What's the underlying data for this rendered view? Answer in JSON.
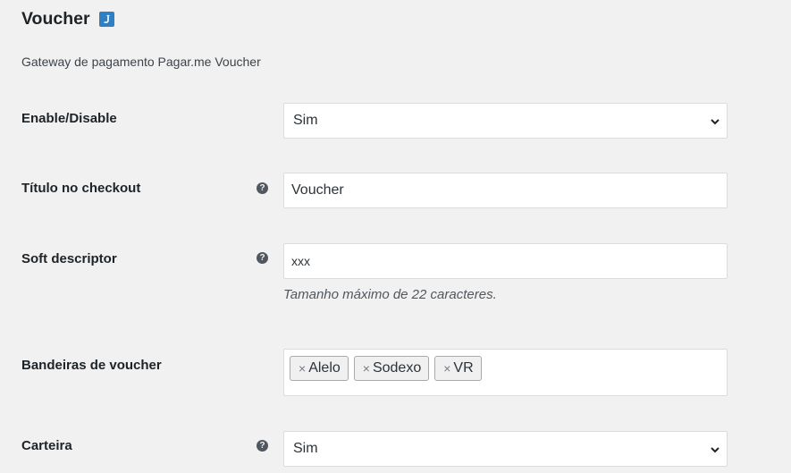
{
  "header": {
    "title": "Voucher",
    "return_icon": "return-arrow-icon",
    "subtitle": "Gateway de pagamento Pagar.me Voucher"
  },
  "fields": {
    "enable": {
      "label": "Enable/Disable",
      "value": "Sim"
    },
    "title": {
      "label": "Título no checkout",
      "value": "Voucher",
      "help_icon": "help-icon"
    },
    "soft_descriptor": {
      "label": "Soft descriptor",
      "value": "xxx",
      "description": "Tamanho máximo de 22 caracteres.",
      "help_icon": "help-icon"
    },
    "brands": {
      "label": "Bandeiras de voucher",
      "remove_symbol": "×",
      "tags": [
        "Alelo",
        "Sodexo",
        "VR"
      ]
    },
    "wallet": {
      "label": "Carteira",
      "value": "Sim",
      "help_icon": "help-icon"
    }
  },
  "help_symbol": "?",
  "colors": {
    "background": "#f1f1f1",
    "accent": "#2f7fc4",
    "border": "#dcdcde",
    "text": "#1d2327"
  }
}
